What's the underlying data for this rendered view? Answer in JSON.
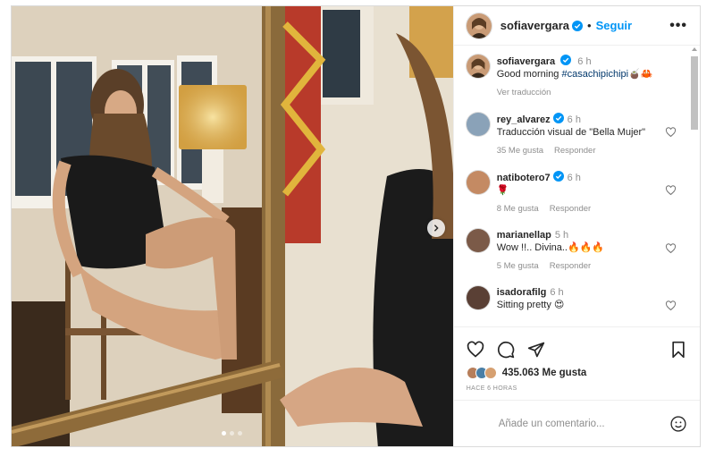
{
  "post": {
    "media": {
      "carousel_total": 3,
      "carousel_active": 0
    },
    "header": {
      "username": "sofiavergara",
      "separator": "•",
      "follow_label": "Seguir",
      "more_label": "•••"
    },
    "caption": {
      "username": "sofiavergara",
      "time": "6 h",
      "text": "Good morning ",
      "hashtag": "#casachipichipi",
      "emoji": "🧉🦀",
      "translate_label": "Ver traducción"
    },
    "comments": [
      {
        "username": "rey_alvarez",
        "verified": true,
        "time": "6 h",
        "text": "Traducción visual de \"Bella Mujer\"",
        "likes": "35 Me gusta",
        "reply": "Responder"
      },
      {
        "username": "natibotero7",
        "verified": true,
        "time": "6 h",
        "text": "🌹",
        "likes": "8 Me gusta",
        "reply": "Responder"
      },
      {
        "username": "marianellap",
        "verified": false,
        "time": "5 h",
        "text": "Wow !!.. Divina..🔥🔥🔥",
        "likes": "5 Me gusta",
        "reply": "Responder"
      },
      {
        "username": "isadorafilg",
        "verified": false,
        "time": "6 h",
        "text": "Sitting pretty 😍",
        "likes": "",
        "reply": ""
      }
    ],
    "likes_label": "435.063 Me gusta",
    "time_ago": "HACE 6 HORAS",
    "add_comment": {
      "placeholder": "Añade un comentario..."
    },
    "colors": {
      "accent": "#0095f6",
      "verified": "#0095f6",
      "muted": "#8e8e8e"
    }
  }
}
